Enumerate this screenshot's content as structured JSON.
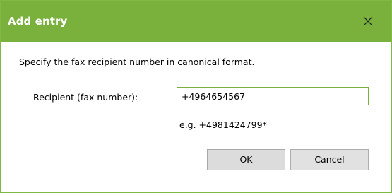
{
  "window": {
    "title": "Add entry",
    "accent_color": "#7ab03c"
  },
  "icons": {
    "close": "close-icon"
  },
  "dialog": {
    "instruction": "Specify the fax recipient number in canonical format.",
    "recipient_label": "Recipient (fax number):",
    "recipient_value": "+4964654567",
    "hint": "e.g. +4981424799*"
  },
  "buttons": {
    "ok_label": "OK",
    "cancel_label": "Cancel"
  }
}
